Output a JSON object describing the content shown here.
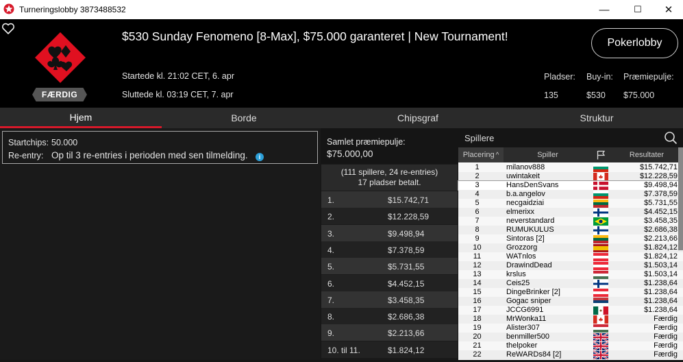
{
  "window": {
    "title": "Turneringslobby 3873488532",
    "minimize": "—",
    "maximize": "☐",
    "close": "✕"
  },
  "header": {
    "title": "$530 Sunday Fenomeno [8-Max], $75.000 garanteret | New Tournament!",
    "badge": "FÆRDIG",
    "started": "Startede kl. 21:02 CET, 6. apr",
    "ended": "Sluttede kl. 03:19 CET, 7. apr",
    "lobby_button": "Pokerlobby",
    "stats": [
      {
        "label": "Pladser:",
        "value": "135"
      },
      {
        "label": "Buy-in:",
        "value": "$530"
      },
      {
        "label": "Præmiepulje:",
        "value": "$75.000"
      }
    ]
  },
  "tabs": [
    "Hjem",
    "Borde",
    "Chipsgraf",
    "Struktur"
  ],
  "info": {
    "startchips_label": "Startchips:",
    "startchips_value": "50.000",
    "reentry_label": "Re-entry:",
    "reentry_value": "Op til 3 re-entries i perioden med sen tilmelding.",
    "info_icon": "i"
  },
  "prizes": {
    "pool_label": "Samlet præmiepulje:",
    "pool_value": "$75.000,00",
    "summary_line1": "(111 spillere, 24 re-entries)",
    "summary_line2": "17 pladser betalt.",
    "rows": [
      {
        "place": "1.",
        "amount": "$15.742,71"
      },
      {
        "place": "2.",
        "amount": "$12.228,59"
      },
      {
        "place": "3.",
        "amount": "$9.498,94"
      },
      {
        "place": "4.",
        "amount": "$7.378,59"
      },
      {
        "place": "5.",
        "amount": "$5.731,55"
      },
      {
        "place": "6.",
        "amount": "$4.452,15"
      },
      {
        "place": "7.",
        "amount": "$3.458,35"
      },
      {
        "place": "8.",
        "amount": "$2.686,38"
      },
      {
        "place": "9.",
        "amount": "$2.213,66"
      },
      {
        "place": "10. til 11.",
        "amount": "$1.824,12"
      }
    ]
  },
  "players": {
    "search_label": "Spillere",
    "columns": {
      "rank": "Placering",
      "player": "Spiller",
      "result": "Resultater"
    },
    "sort_arrow": "^",
    "rows": [
      {
        "rank": "1",
        "name": "milanov888",
        "flag": "bulgaria",
        "result": "$15.742,71"
      },
      {
        "rank": "2",
        "name": "uwintakeit",
        "flag": "canada",
        "result": "$12.228,59"
      },
      {
        "rank": "3",
        "name": "HansDenSvans",
        "flag": "denmark",
        "result": "$9.498,94"
      },
      {
        "rank": "4",
        "name": "b.a.angelov",
        "flag": "bulgaria",
        "result": "$7.378,59"
      },
      {
        "rank": "5",
        "name": "necgaidziai",
        "flag": "lithuania",
        "result": "$5.731,55"
      },
      {
        "rank": "6",
        "name": "elmerixx",
        "flag": "finland",
        "result": "$4.452,15"
      },
      {
        "rank": "7",
        "name": "neverstandard",
        "flag": "brazil",
        "result": "$3.458,35"
      },
      {
        "rank": "8",
        "name": "RUMUKULUS",
        "flag": "finland",
        "result": "$2.686,38"
      },
      {
        "rank": "9",
        "name": "Sintoras [2]",
        "flag": "lithuania",
        "result": "$2.213,66"
      },
      {
        "rank": "10",
        "name": "Grozzorg",
        "flag": "spain",
        "result": "$1.824,12"
      },
      {
        "rank": "11",
        "name": "WATnlos",
        "flag": "austria",
        "result": "$1.824,12"
      },
      {
        "rank": "12",
        "name": "DrawindDead",
        "flag": "austria",
        "result": "$1.503,14"
      },
      {
        "rank": "13",
        "name": "krslus",
        "flag": "hungary",
        "result": "$1.503,14"
      },
      {
        "rank": "14",
        "name": "Ceis25",
        "flag": "finland",
        "result": "$1.238,64"
      },
      {
        "rank": "15",
        "name": "DingeBrinker [2]",
        "flag": "austria",
        "result": "$1.238,64"
      },
      {
        "rank": "16",
        "name": "Gogac sniper",
        "flag": "serbia",
        "result": "$1.238,64"
      },
      {
        "rank": "17",
        "name": "JCCG6991",
        "flag": "mexico",
        "result": "$1.238,64"
      },
      {
        "rank": "18",
        "name": "MrWonka11",
        "flag": "canada",
        "result": "Færdig"
      },
      {
        "rank": "19",
        "name": "Alister307",
        "flag": "hungary",
        "result": "Færdig"
      },
      {
        "rank": "20",
        "name": "benmiller500",
        "flag": "uk",
        "result": "Færdig"
      },
      {
        "rank": "21",
        "name": "thelpoker",
        "flag": "uk",
        "result": "Færdig"
      },
      {
        "rank": "22",
        "name": "ReWARDs84 [2]",
        "flag": "uk",
        "result": "Færdig"
      }
    ]
  },
  "colors": {
    "accent": "#d7192a",
    "highlight_row": "#ffffff",
    "info": "#2b9fd8"
  }
}
